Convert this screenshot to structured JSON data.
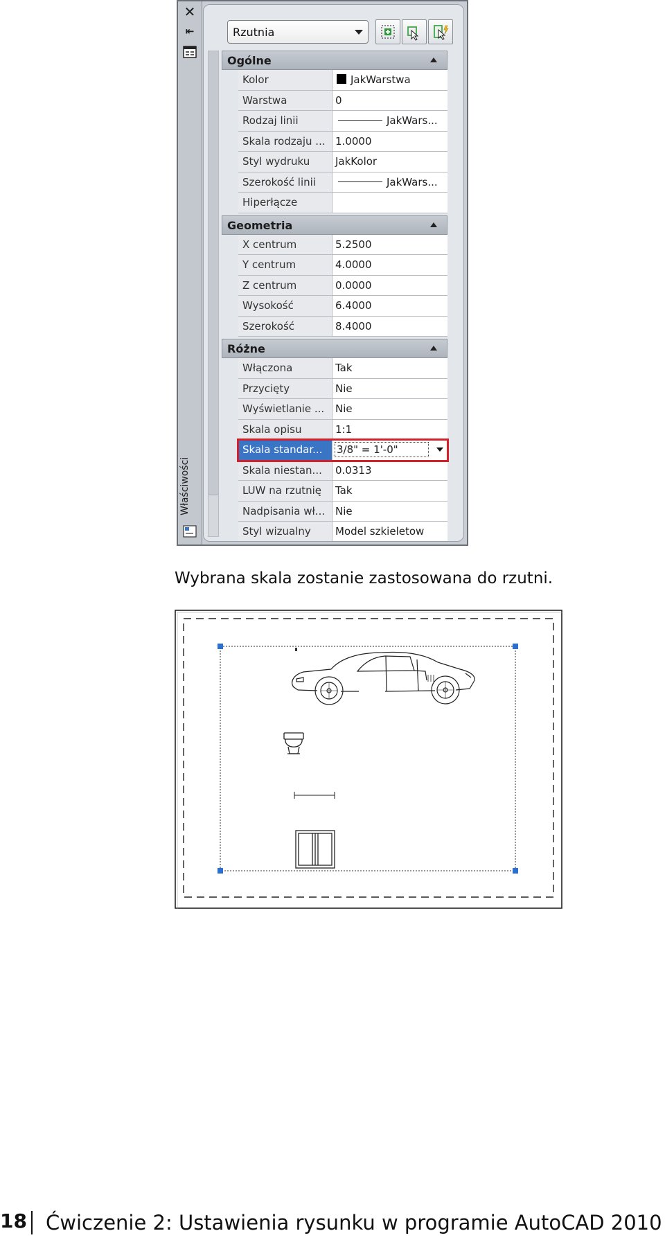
{
  "palette": {
    "vertical_title": "Właściwości",
    "object_type": "Rzutnia",
    "toolbar": {
      "toggle_pickadd_icon": "pickadd-icon",
      "select_objects_icon": "select-objects-icon",
      "quick_select_icon": "quick-select-icon"
    },
    "sections": [
      {
        "title": "Ogólne",
        "rows": [
          {
            "name": "Kolor",
            "value": "JakWarstwa",
            "swatch": "#000000"
          },
          {
            "name": "Warstwa",
            "value": "0"
          },
          {
            "name": "Rodzaj linii",
            "value": "JakWars...",
            "line": true
          },
          {
            "name": "Skala rodzaju ...",
            "value": "1.0000"
          },
          {
            "name": "Styl wydruku",
            "value": "JakKolor"
          },
          {
            "name": "Szerokość linii",
            "value": "JakWars...",
            "line": true
          },
          {
            "name": "Hiperłącze",
            "value": ""
          }
        ]
      },
      {
        "title": "Geometria",
        "rows": [
          {
            "name": "X centrum",
            "value": "5.2500"
          },
          {
            "name": "Y centrum",
            "value": "4.0000"
          },
          {
            "name": "Z centrum",
            "value": "0.0000"
          },
          {
            "name": "Wysokość",
            "value": "6.4000"
          },
          {
            "name": "Szerokość",
            "value": "8.4000"
          }
        ]
      },
      {
        "title": "Różne",
        "rows": [
          {
            "name": "Włączona",
            "value": "Tak"
          },
          {
            "name": "Przycięty",
            "value": "Nie"
          },
          {
            "name": "Wyświetlanie ...",
            "value": "Nie"
          },
          {
            "name": "Skala opisu",
            "value": "1:1"
          },
          {
            "name": "Skala standar...",
            "value": "3/8\" = 1'-0\"",
            "selected": true
          },
          {
            "name": "Skala niestan...",
            "value": "0.0313"
          },
          {
            "name": "LUW na rzutnię",
            "value": "Tak"
          },
          {
            "name": "Nadpisania wł...",
            "value": "Nie"
          },
          {
            "name": "Styl wizualny",
            "value": "Model szkieletow"
          }
        ]
      }
    ]
  },
  "caption": "Wybrana skala zostanie zastosowana do rzutni.",
  "footer": {
    "page_number": "18",
    "chapter_title": "Ćwiczenie 2: Ustawienia rysunku w programie AutoCAD 2010"
  }
}
